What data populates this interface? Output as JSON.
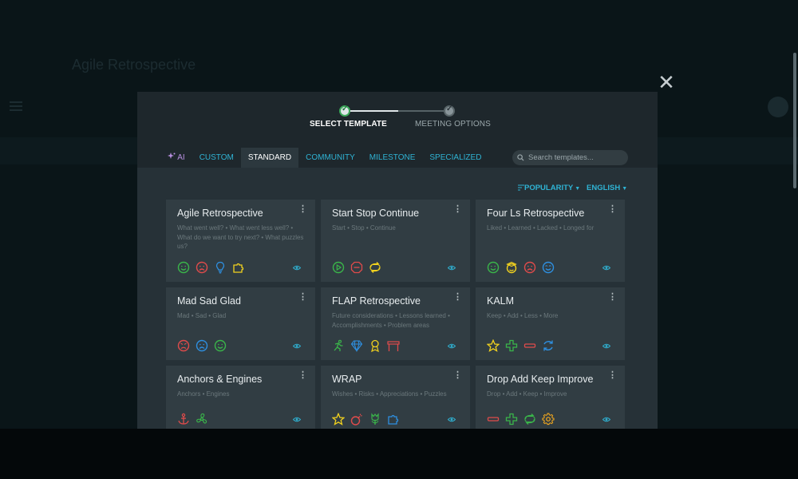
{
  "background": {
    "page_title": "Agile Retrospective"
  },
  "stepper": {
    "steps": [
      {
        "label": "SELECT TEMPLATE",
        "state": "done"
      },
      {
        "label": "MEETING OPTIONS",
        "state": "pending"
      }
    ]
  },
  "tabs": [
    {
      "label": "AI",
      "active": false
    },
    {
      "label": "CUSTOM",
      "active": false
    },
    {
      "label": "STANDARD",
      "active": true
    },
    {
      "label": "COMMUNITY",
      "active": false
    },
    {
      "label": "MILESTONE",
      "active": false
    },
    {
      "label": "SPECIALIZED",
      "active": false
    }
  ],
  "search": {
    "placeholder": "Search templates..."
  },
  "sort": {
    "popularity": "POPULARITY",
    "language": "ENGLISH"
  },
  "colors": {
    "accent": "#2fb3d4",
    "green": "#3ab54a",
    "red": "#e04b4b",
    "yellow": "#f2d21e",
    "blue": "#2e8fe0"
  },
  "cards": [
    {
      "title": "Agile Retrospective",
      "desc": "What went well? • What went less well? • What do we want to try next? • What puzzles us?",
      "icons": [
        "smile-icon",
        "frown-icon",
        "lightbulb-icon",
        "puzzle-icon"
      ]
    },
    {
      "title": "Start Stop Continue",
      "desc": "Start • Stop • Continue",
      "icons": [
        "play-icon",
        "stop-sign-icon",
        "cycle-icon"
      ]
    },
    {
      "title": "Four Ls Retrospective",
      "desc": "Liked • Learned • Lacked • Longed for",
      "icons": [
        "smile-icon",
        "graduate-icon",
        "frown-icon",
        "wish-icon"
      ]
    },
    {
      "title": "Mad Sad Glad",
      "desc": "Mad • Sad • Glad",
      "icons": [
        "mad-icon",
        "sad-icon",
        "glad-icon"
      ]
    },
    {
      "title": "FLAP Retrospective",
      "desc": "Future considerations • Lessons learned • Accomplishments • Problem areas",
      "icons": [
        "runner-icon",
        "diamond-icon",
        "trophy-icon",
        "hurdle-icon"
      ]
    },
    {
      "title": "KALM",
      "desc": "Keep • Add • Less • More",
      "icons": [
        "star-icon",
        "plus-icon",
        "minus-icon",
        "refresh-icon"
      ]
    },
    {
      "title": "Anchors & Engines",
      "desc": "Anchors • Engines",
      "icons": [
        "anchor-icon",
        "fan-icon"
      ]
    },
    {
      "title": "WRAP",
      "desc": "Wishes • Risks • Appreciations • Puzzles",
      "icons": [
        "star-icon",
        "bomb-icon",
        "flower-icon",
        "puzzle-icon"
      ]
    },
    {
      "title": "Drop Add Keep Improve",
      "desc": "Drop • Add • Keep • Improve",
      "icons": [
        "minus-icon",
        "plus-icon",
        "cycle-icon",
        "gear-icon"
      ]
    }
  ]
}
